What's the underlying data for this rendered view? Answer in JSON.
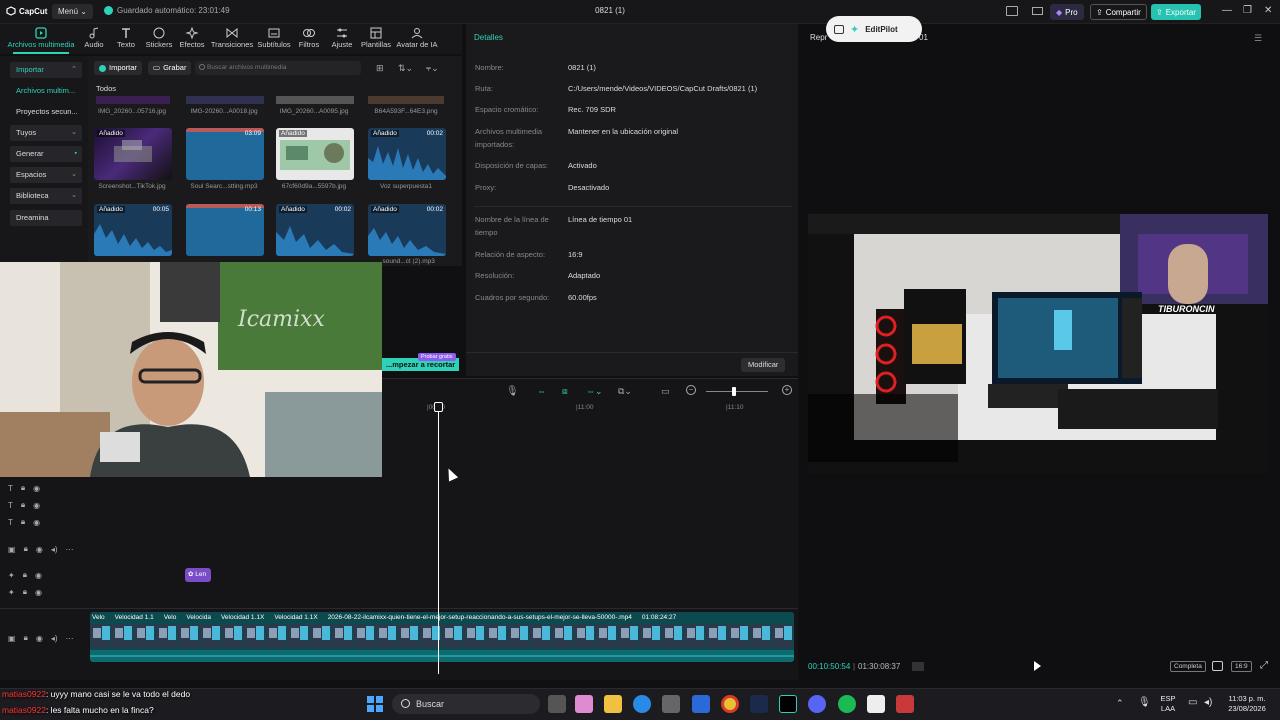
{
  "titlebar": {
    "app_name": "CapCut",
    "menu_label": "Menú",
    "autosave": "Guardado automático: 23:01:49",
    "window_title": "0821 (1)",
    "pro_label": "Pro",
    "share_label": "Compartir",
    "export_label": "Exportar"
  },
  "tabs": [
    {
      "label": "Archivos multimedia",
      "icon": "media-icon"
    },
    {
      "label": "Audio",
      "icon": "audio-icon"
    },
    {
      "label": "Texto",
      "icon": "text-icon"
    },
    {
      "label": "Stickers",
      "icon": "sticker-icon"
    },
    {
      "label": "Efectos",
      "icon": "effects-icon"
    },
    {
      "label": "Transiciones",
      "icon": "transitions-icon"
    },
    {
      "label": "Subtítulos",
      "icon": "subtitles-icon"
    },
    {
      "label": "Filtros",
      "icon": "filters-icon"
    },
    {
      "label": "Ajuste",
      "icon": "adjust-icon"
    },
    {
      "label": "Plantillas",
      "icon": "templates-icon"
    },
    {
      "label": "Avatar de IA",
      "icon": "avatar-icon"
    }
  ],
  "leftnav": {
    "items": [
      "Importar",
      "Archivos multim...",
      "Proyectos secun...",
      "Tuyos",
      "Generar",
      "Espacios",
      "Biblioteca",
      "Dreamina"
    ]
  },
  "media": {
    "import_label": "Importar",
    "record_label": "Grabar",
    "search_placeholder": "Buscar archivos multimedia",
    "section_label": "Todos",
    "top_captions": [
      "IMG_20260...05716.jpg",
      "IMG-20260...A0018.jpg",
      "IMG_20260...A0095.jpg",
      "B64A593F...64E3.png"
    ],
    "items": [
      {
        "badge": "Añadido",
        "duration": "",
        "caption": "Screenshot...TikTok.jpg"
      },
      {
        "badge": "",
        "duration": "03:09",
        "caption": "Soul Searc...stting.mp3"
      },
      {
        "badge": "Añadido",
        "duration": "",
        "caption": "67cf60d9a...5597b.jpg"
      },
      {
        "badge": "Añadido",
        "duration": "00:02",
        "caption": "Voz superpuesta1"
      },
      {
        "badge": "Añadido",
        "duration": "00:05",
        "caption": ""
      },
      {
        "badge": "",
        "duration": "00:13",
        "caption": ""
      },
      {
        "badge": "Añadido",
        "duration": "00:02",
        "caption": ""
      },
      {
        "badge": "Añadido",
        "duration": "00:02",
        "caption": "...sound...ct (2).mp3"
      }
    ]
  },
  "details": {
    "title": "Detalles",
    "rows": [
      {
        "label": "Nombre:",
        "value": "0821 (1)"
      },
      {
        "label": "Ruta:",
        "value": "C:/Users/mende/Videos/VIDEOS/CapCut Drafts/0821 (1)"
      },
      {
        "label": "Espacio cromático:",
        "value": "Rec. 709 SDR"
      },
      {
        "label": "Archivos multimedia importados:",
        "value": "Mantener en la ubicación original"
      },
      {
        "label": "Disposición de capas:",
        "value": "Activado"
      },
      {
        "label": "Proxy:",
        "value": "Desactivado"
      },
      {
        "label": "Nombre de la línea de tiempo",
        "value": "Línea de tiempo 01"
      },
      {
        "label": "Relación de aspecto:",
        "value": "16:9"
      },
      {
        "label": "Resolución:",
        "value": "Adaptado"
      },
      {
        "label": "Cuadros por segundo:",
        "value": "60.00fps"
      }
    ],
    "modify_label": "Modificar"
  },
  "player": {
    "label": "Repr",
    "label_suffix": "01",
    "editpilot_label": "EditPilot",
    "current_time": "00:10:50:54",
    "total_time": "01:30:08:37",
    "full_label": "Completa",
    "ratio_label": "16:9",
    "overlay_brand": "TIBURONCIN"
  },
  "timeline": {
    "ruler": [
      "|00:10",
      "|11:00",
      "|11:10"
    ],
    "sticker_clip_label": "Len",
    "clip_labels": [
      "Velo",
      "Velocidad 1.1",
      "Velo",
      "Velocida",
      "Velocidad 1.1X",
      "Velocidad 1.1X",
      "2026-08-22-ilcamixx-quien-tiene-el-mejor-setup-reaccionando-a-sus-setups-el-mejor-se-lleva-50000-.mp4",
      "01:08:24:27"
    ]
  },
  "overlay": {
    "recortar_label": "...mpezar a recortar",
    "prob_badge": "Probar gratis",
    "wall_sign": "Icamixx",
    "chat": [
      {
        "user": "matias0922",
        "text": ": uyyy mano casi se le va todo el dedo"
      },
      {
        "user": "matias0922",
        "text": ": les falta mucho en la finca?"
      }
    ]
  },
  "taskbar": {
    "search_label": "Buscar",
    "lang_top": "ESP",
    "lang_bottom": "LAA",
    "time": "11:03 p. m.",
    "date": "23/08/2026"
  },
  "colors": {
    "accent": "#2ed3b7",
    "clip": "#0d4a4f",
    "sticker": "#7b4cc8",
    "chat_user": "#ff3333"
  }
}
